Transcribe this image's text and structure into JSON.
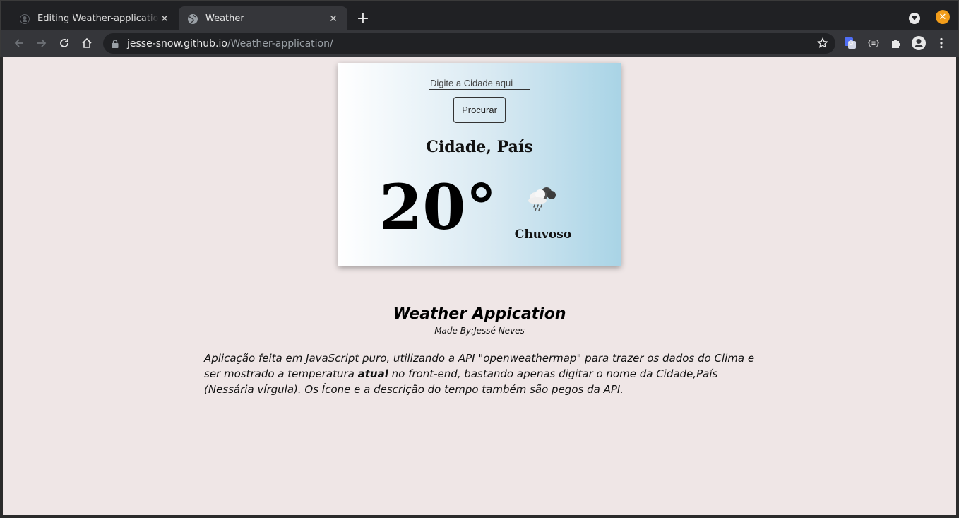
{
  "browser": {
    "tabs": [
      {
        "title": "Editing Weather-application/",
        "favicon": "github-icon",
        "active": false
      },
      {
        "title": "Weather",
        "favicon": "globe-icon",
        "active": true
      }
    ],
    "address": {
      "host": "jesse-snow.github.io",
      "path": "/Weather-application/"
    }
  },
  "weather_card": {
    "input_placeholder": "Digite a Cidade aqui",
    "search_label": "Procurar",
    "location": "Cidade, País",
    "temperature": "20°",
    "description": "Chuvoso",
    "icon": "rain-cloud-icon"
  },
  "about": {
    "title": "Weather Appication",
    "made_by": "Made By:Jessé Neves",
    "text_before": "Aplicação feita em JavaScript puro, utilizando a API \"openweathermap\" para trazer os dados do Clima e ser mostrado a temperatura ",
    "text_bold": "atual",
    "text_after": " no front-end, bastando apenas digitar o nome da Cidade,País (Nessária vírgula). Os Ícone e a descrição do tempo também são pegos da API."
  },
  "colors": {
    "page_background": "#efe6e6",
    "card_gradient_end": "#a9d4e6",
    "window_close": "#f29d1a"
  }
}
